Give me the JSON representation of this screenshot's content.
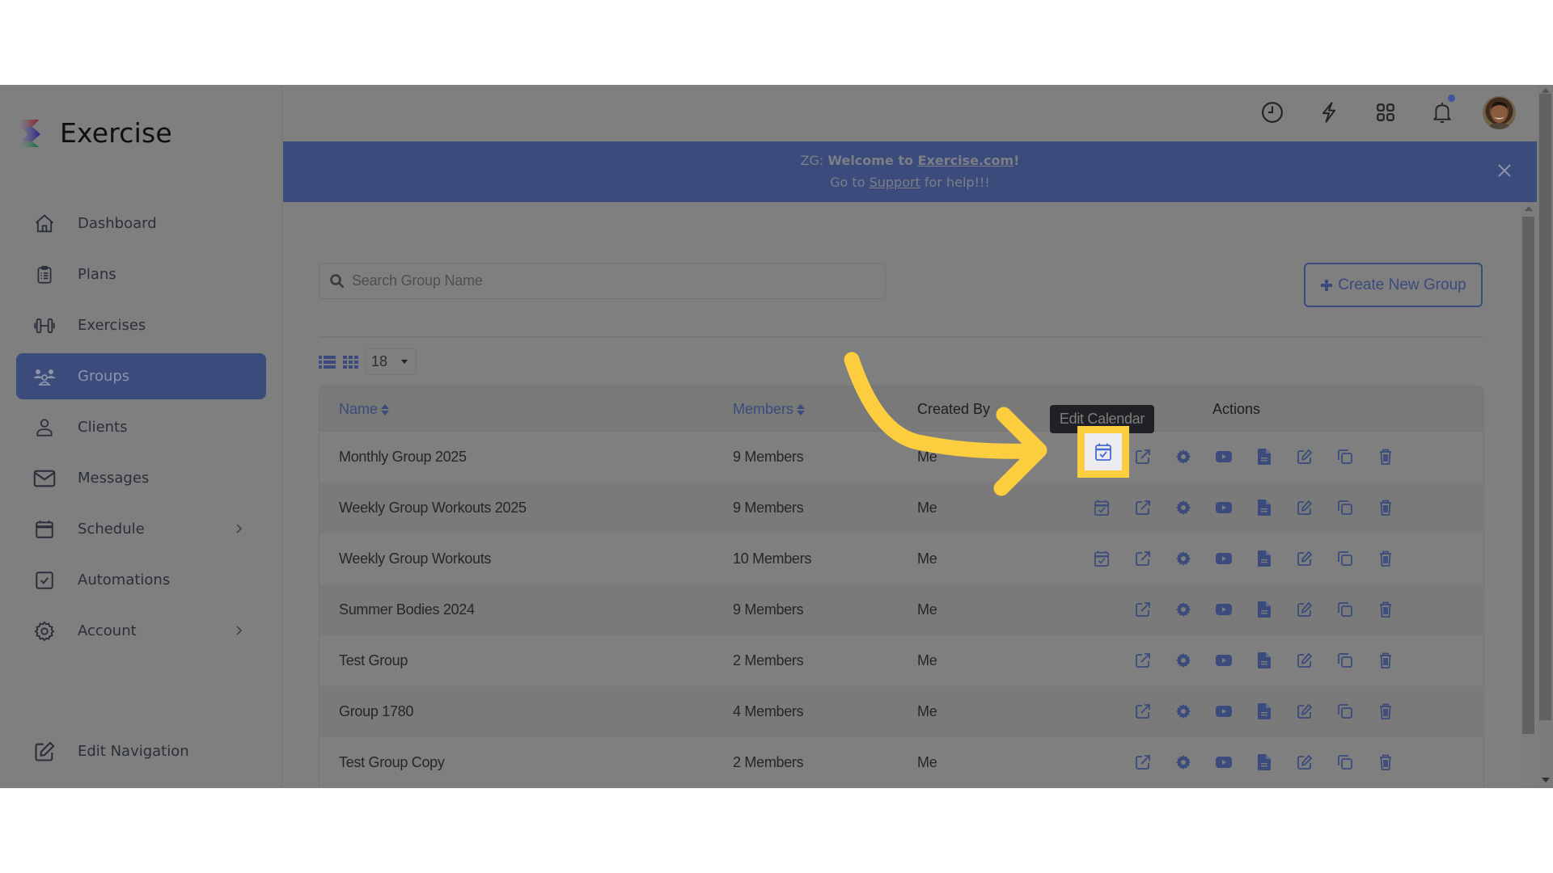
{
  "app": {
    "brand": "Exercise"
  },
  "sidebar": {
    "items": [
      {
        "label": "Dashboard",
        "icon": "home-icon",
        "active": false
      },
      {
        "label": "Plans",
        "icon": "clipboard-icon",
        "active": false
      },
      {
        "label": "Exercises",
        "icon": "dumbbell-icon",
        "active": false
      },
      {
        "label": "Groups",
        "icon": "users-icon",
        "active": true
      },
      {
        "label": "Clients",
        "icon": "user-icon",
        "active": false
      },
      {
        "label": "Messages",
        "icon": "mail-icon",
        "active": false
      },
      {
        "label": "Schedule",
        "icon": "calendar-icon",
        "active": false,
        "has_submenu": true
      },
      {
        "label": "Automations",
        "icon": "checkbox-icon",
        "active": false
      },
      {
        "label": "Account",
        "icon": "gear-icon",
        "active": false,
        "has_submenu": true
      }
    ],
    "bottom": {
      "label": "Edit Navigation",
      "icon": "edit-icon"
    }
  },
  "topbar": {
    "icons": [
      "clock-icon",
      "lightning-icon",
      "apps-grid-icon",
      "bell-icon"
    ],
    "has_notification": true,
    "avatar": "user-avatar"
  },
  "banner": {
    "prefix": "ZG: ",
    "welcome": "Welcome to ",
    "link1": "Exercise.com",
    "bang": "!",
    "goto": "Go to ",
    "link2": "Support",
    "suffix": " for help!!!"
  },
  "search": {
    "placeholder": "Search Group Name",
    "value": ""
  },
  "create_button": {
    "label": "Create New Group"
  },
  "view": {
    "page_size": "18"
  },
  "table": {
    "headers": {
      "name": "Name",
      "members": "Members",
      "created_by": "Created By",
      "actions": "Actions"
    },
    "rows": [
      {
        "name": "Monthly Group 2025",
        "members": "9 Members",
        "created_by": "Me",
        "has_calendar": true
      },
      {
        "name": "Weekly Group Workouts 2025",
        "members": "9 Members",
        "created_by": "Me",
        "has_calendar": true
      },
      {
        "name": "Weekly Group Workouts",
        "members": "10 Members",
        "created_by": "Me",
        "has_calendar": true
      },
      {
        "name": "Summer Bodies 2024",
        "members": "9 Members",
        "created_by": "Me",
        "has_calendar": false
      },
      {
        "name": "Test Group",
        "members": "2 Members",
        "created_by": "Me",
        "has_calendar": false
      },
      {
        "name": "Group 1780",
        "members": "4 Members",
        "created_by": "Me",
        "has_calendar": false
      },
      {
        "name": "Test Group Copy",
        "members": "2 Members",
        "created_by": "Me",
        "has_calendar": false
      }
    ],
    "action_icons": [
      "calendar-check-icon",
      "external-link-icon",
      "gear-icon",
      "video-icon",
      "document-icon",
      "edit-icon",
      "copy-icon",
      "trash-icon"
    ]
  },
  "tooltip": {
    "text": "Edit Calendar"
  },
  "colors": {
    "accent": "#3a4b7c",
    "highlight": "#fcce3f",
    "overlay_bg": "#7f7f7f"
  }
}
